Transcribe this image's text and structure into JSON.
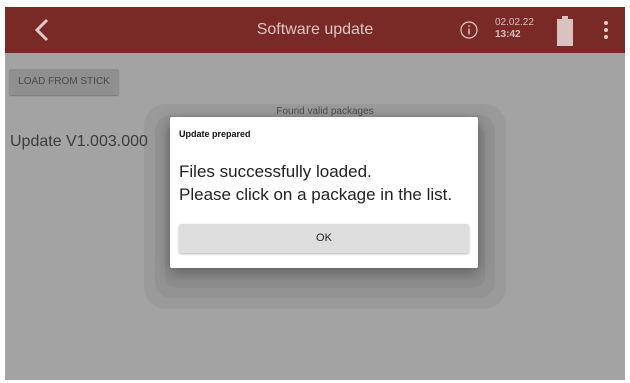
{
  "header": {
    "title": "Software update",
    "date": "02.02.22",
    "time": "13:42",
    "icons": [
      "back-icon",
      "info-icon",
      "battery-icon",
      "menu-icon"
    ],
    "bar_color": "#7a2a26"
  },
  "toolbar": {
    "load_label": "LOAD FROM STICK"
  },
  "packages": {
    "label": "Found valid packages",
    "items": [
      "Update V1.003.000"
    ]
  },
  "dialog": {
    "title": "Update prepared",
    "line1": "Files successfully loaded.",
    "line2": "Please click on a package in the list.",
    "ok_label": "OK"
  }
}
